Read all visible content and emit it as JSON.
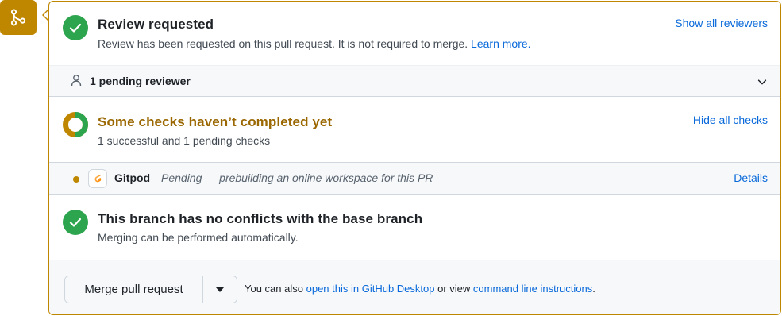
{
  "colors": {
    "attention": "#bf8700",
    "success": "#2da44e",
    "link": "#0969da"
  },
  "badge": {
    "icon": "git-merge-icon"
  },
  "review": {
    "title": "Review requested",
    "description": "Review has been requested on this pull request. It is not required to merge.",
    "learn_more": "Learn more.",
    "show_all": "Show all reviewers",
    "icon": "check-circle-icon"
  },
  "pending": {
    "label": "1 pending reviewer",
    "icon": "person-icon",
    "toggle_icon": "chevron-down-icon"
  },
  "checks": {
    "title": "Some checks haven’t completed yet",
    "summary": "1 successful and 1 pending checks",
    "hide_all": "Hide all checks",
    "icon": "pending-ring-icon",
    "items": [
      {
        "name": "Gitpod",
        "status": "pending",
        "description": "Pending — prebuilding an online workspace for this PR",
        "details": "Details",
        "logo": "gitpod-logo-icon"
      }
    ]
  },
  "conflicts": {
    "title": "This branch has no conflicts with the base branch",
    "description": "Merging can be performed automatically.",
    "icon": "check-circle-icon"
  },
  "merge": {
    "button_label": "Merge pull request",
    "caret_icon": "triangle-down-icon",
    "note_prefix": "You can also",
    "desktop_link": "open this in GitHub Desktop",
    "note_middle": "or view",
    "cli_link": "command line instructions",
    "note_suffix": "."
  }
}
